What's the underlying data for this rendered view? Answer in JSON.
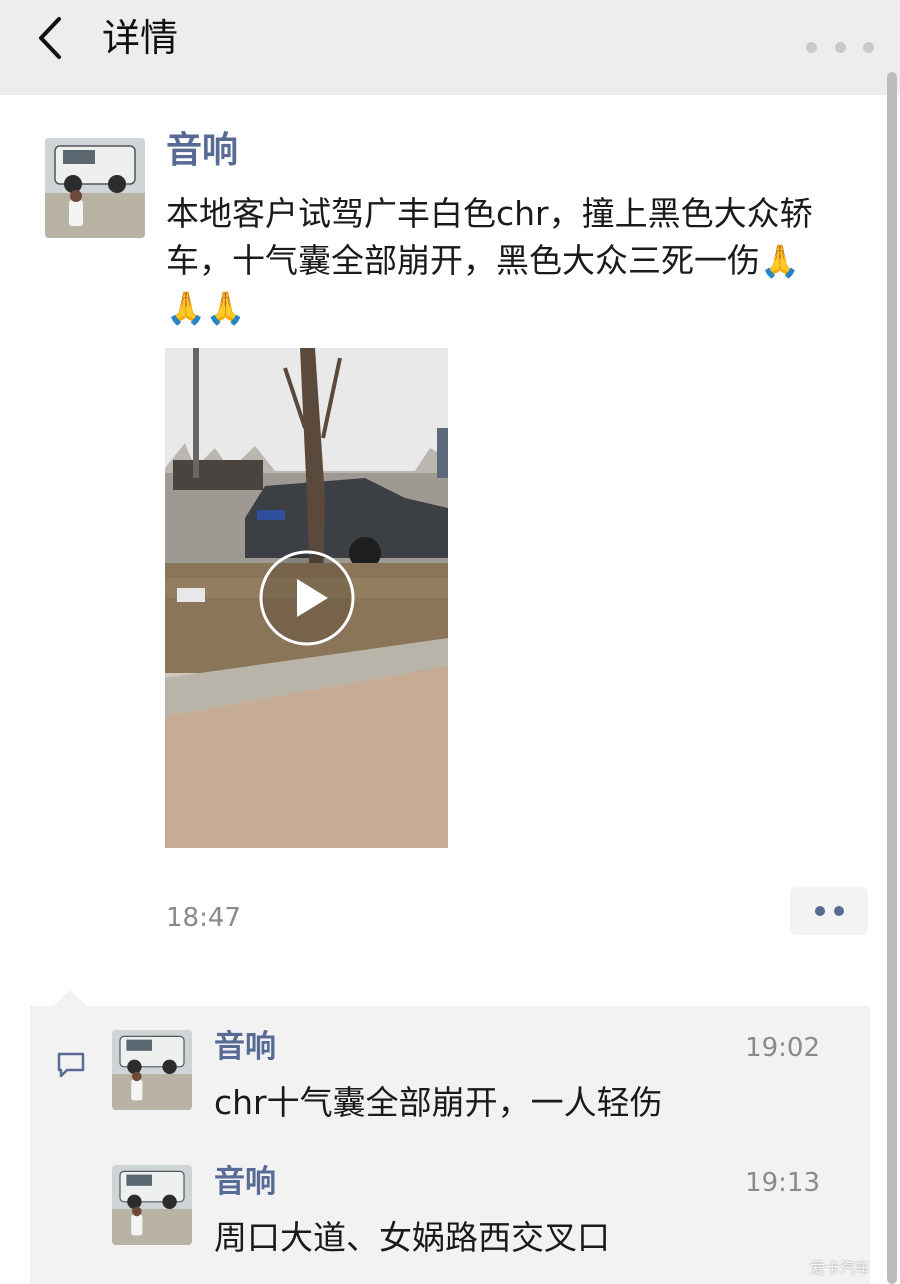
{
  "nav": {
    "title": "详情"
  },
  "post": {
    "author": "音响",
    "text_main": "本地客户试驾广丰白色chr，撞上黑色大众轿车，十气囊全部崩开，黑色大众三死一伤",
    "emojis": [
      "🙏",
      "🙏",
      "🙏"
    ],
    "time": "18:47"
  },
  "comments": [
    {
      "author": "音响",
      "time": "19:02",
      "text": "chr十气囊全部崩开，一人轻伤"
    },
    {
      "author": "音响",
      "time": "19:13",
      "text": "周口大道、女娲路西交叉口"
    }
  ],
  "watermark": "爱卡汽车",
  "colors": {
    "link_blue": "#576b95",
    "nav_bg": "#ededed",
    "comment_bg": "#f2f2f2",
    "time_gray": "#8a8a8a"
  },
  "icons": {
    "back": "chevron-left-icon",
    "more": "more-dots-icon",
    "play": "play-icon",
    "comment": "comment-bubble-icon",
    "action": "action-dots-icon",
    "emoji": "praying-hands-icon"
  }
}
